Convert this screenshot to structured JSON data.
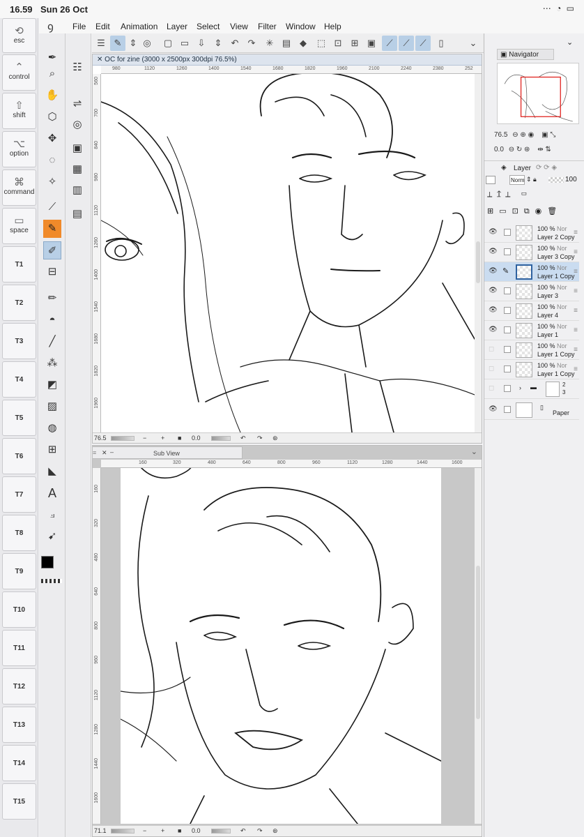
{
  "status_bar": {
    "time": "16.59",
    "date": "Sun 26 Oct"
  },
  "modifier_keys": [
    {
      "label": "esc",
      "icon": "esc-icon"
    },
    {
      "label": "control",
      "icon": "chevron-up-icon"
    },
    {
      "label": "shift",
      "icon": "shift-arrow-icon"
    },
    {
      "label": "option",
      "icon": "option-icon"
    },
    {
      "label": "command",
      "icon": "command-icon"
    },
    {
      "label": "space",
      "icon": "space-bar-icon"
    }
  ],
  "shortcut_keys": [
    "T1",
    "T2",
    "T3",
    "T4",
    "T5",
    "T6",
    "T7",
    "T8",
    "T9",
    "T10",
    "T11",
    "T12",
    "T13",
    "T14",
    "T15"
  ],
  "menu": [
    "File",
    "Edit",
    "Animation",
    "Layer",
    "Select",
    "View",
    "Filter",
    "Window",
    "Help"
  ],
  "main_view": {
    "tab_title": "OC for zine (3000 x 2500px 300dpi 76.5%)",
    "ruler_h": [
      "980",
      "1120",
      "1260",
      "1400",
      "1540",
      "1680",
      "1820",
      "1960",
      "2100",
      "2240",
      "2380",
      "252"
    ],
    "ruler_v": [
      "560",
      "700",
      "840",
      "980",
      "1120",
      "1260",
      "1400",
      "1540",
      "1680",
      "1820",
      "1960"
    ],
    "zoom": "76.5",
    "rotation": "0.0"
  },
  "sub_view": {
    "title": "Sub View",
    "ruler_h": [
      "160",
      "320",
      "480",
      "640",
      "800",
      "960",
      "1120",
      "1280",
      "1440",
      "1600"
    ],
    "ruler_v": [
      "160",
      "320",
      "480",
      "640",
      "800",
      "960",
      "1120",
      "1280",
      "1440",
      "1600"
    ],
    "zoom": "71.1",
    "rotation": "0.0"
  },
  "navigator": {
    "title": "Navigator",
    "zoom": "76.5",
    "rotation": "0.0"
  },
  "layer_panel": {
    "title": "Layer",
    "blend_mode": "Norm",
    "opacity": "100",
    "layers": [
      {
        "opacity": "100 %",
        "mode": "Nor",
        "name": "Layer 2 Copy",
        "visible": true,
        "selected": false
      },
      {
        "opacity": "100 %",
        "mode": "Nor",
        "name": "Layer 3 Copy",
        "visible": true,
        "selected": false
      },
      {
        "opacity": "100 %",
        "mode": "Nor",
        "name": "Layer 1 Copy",
        "visible": true,
        "selected": true
      },
      {
        "opacity": "100 %",
        "mode": "Nor",
        "name": "Layer 3",
        "visible": true,
        "selected": false
      },
      {
        "opacity": "100 %",
        "mode": "Nor",
        "name": "Layer 4",
        "visible": true,
        "selected": false
      },
      {
        "opacity": "100 %",
        "mode": "Nor",
        "name": "Layer 1",
        "visible": true,
        "selected": false
      },
      {
        "opacity": "100 %",
        "mode": "Nor",
        "name": "Layer 1 Copy",
        "visible": false,
        "selected": false
      },
      {
        "opacity": "100 %",
        "mode": "Nor",
        "name": "Layer 1 Copy",
        "visible": false,
        "selected": false
      }
    ],
    "folder": {
      "opacity": "2",
      "name": "3"
    },
    "paper": {
      "name": "Paper"
    }
  }
}
